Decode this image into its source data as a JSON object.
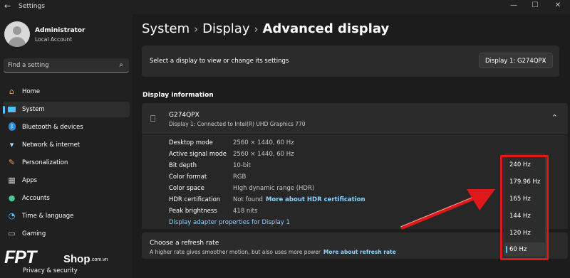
{
  "window": {
    "title": "Settings",
    "back_icon": "←",
    "minimize": "—",
    "maximize": "☐",
    "close": "✕"
  },
  "user": {
    "name": "Administrator",
    "account_type": "Local Account"
  },
  "search": {
    "placeholder": "Find a setting"
  },
  "sidebar": {
    "items": [
      {
        "label": "Home",
        "icon": "home-icon",
        "color": "#f0a050"
      },
      {
        "label": "System",
        "icon": "system-icon",
        "color": "#4cc2ff",
        "active": true
      },
      {
        "label": "Bluetooth & devices",
        "icon": "bluetooth-icon",
        "color": "#4cc2ff"
      },
      {
        "label": "Network & internet",
        "icon": "wifi-icon",
        "color": "#a6d8ff"
      },
      {
        "label": "Personalization",
        "icon": "brush-icon",
        "color": "#e8a060"
      },
      {
        "label": "Apps",
        "icon": "apps-icon",
        "color": "#c8c8c8"
      },
      {
        "label": "Accounts",
        "icon": "accounts-icon",
        "color": "#48c78e"
      },
      {
        "label": "Time & language",
        "icon": "globe-icon",
        "color": "#4cc2ff"
      },
      {
        "label": "Gaming",
        "icon": "gamepad-icon",
        "color": "#c8c8c8"
      },
      {
        "label": "Privacy & security",
        "icon": "shield-icon",
        "color": "#c8c8c8"
      }
    ]
  },
  "breadcrumb": {
    "items": [
      "System",
      "Display",
      "Advanced display"
    ],
    "separator": "›"
  },
  "display_select": {
    "prompt": "Select a display to view or change its settings",
    "value": "Display 1: G274QPX"
  },
  "display_info": {
    "section_title": "Display information",
    "monitor_name": "G274QPX",
    "monitor_sub": "Display 1: Connected to Intel(R) UHD Graphics 770",
    "rows": [
      {
        "key": "Desktop mode",
        "value": "2560 × 1440, 60 Hz"
      },
      {
        "key": "Active signal mode",
        "value": "2560 × 1440, 60 Hz"
      },
      {
        "key": "Bit depth",
        "value": "10-bit"
      },
      {
        "key": "Color format",
        "value": "RGB"
      },
      {
        "key": "Color space",
        "value": "High dynamic range (HDR)"
      },
      {
        "key": "HDR certification",
        "value": "Not found",
        "link": "More about HDR certification"
      },
      {
        "key": "Peak brightness",
        "value": "418 nits"
      }
    ],
    "adapter_link": "Display adapter properties for Display 1"
  },
  "refresh_rate": {
    "title": "Choose a refresh rate",
    "description": "A higher rate gives smoother motion, but also uses more power",
    "link": "More about refresh rate",
    "options": [
      "240 Hz",
      "179.96 Hz",
      "165 Hz",
      "144 Hz",
      "120 Hz",
      "60 Hz"
    ],
    "selected": "60 Hz"
  },
  "watermark": {
    "brand": "FPT",
    "shop": "Shop",
    "domain": ".com.vn"
  },
  "colors": {
    "accent": "#4cc2ff",
    "link": "#8fd3ff",
    "highlight_red": "#e01818"
  }
}
